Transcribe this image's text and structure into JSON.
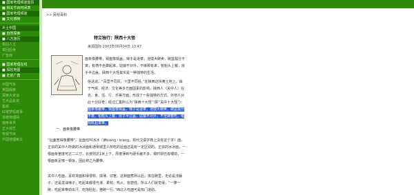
{
  "sidebar": {
    "items": [
      {
        "label": "■ 国家地理频道首页"
      },
      {
        "label": "■ 相关节目时间表"
      },
      {
        "label": "■ 国家地理频道"
      },
      {
        "label": "■ 文化博物"
      },
      {
        "label": "乡土中国"
      },
      {
        "label": "■ 自然探索"
      },
      {
        "label": "■ 八方游历"
      },
      {
        "label": "章回人文"
      },
      {
        "label": "章回后世"
      },
      {
        "label": "广告商"
      },
      {
        "label": "■ 国家地理在线"
      },
      {
        "label": "■ 探险地图"
      },
      {
        "label": "■ 史前广角"
      },
      {
        "label": "中国气象"
      },
      {
        "label": "英国探索"
      },
      {
        "label": "探索大家谈"
      },
      {
        "label": "艺术品投资"
      },
      {
        "label": "集邮"
      },
      {
        "label": "红楼梦短故事"
      },
      {
        "label": "求修地理网"
      },
      {
        "label": "咖啡世界"
      },
      {
        "label": "正大综艺"
      },
      {
        "label": "电视节目"
      },
      {
        "label": "中国地理索文"
      }
    ]
  },
  "breadcrumb": ">> 民俗百科",
  "article": {
    "title": "特立独行：陕西十大怪",
    "meta": "来源国际  2003年06月04日 13:47",
    "p1": "面条像腰带，锅盔像锅盖，辣子是道菜，泡馍大碗卖，碗盆瓢分不离，有椅不坐蹲起来，姑娘不对外，不嫁那有来，帕帕头上戴，房子半边盖。陕西十大怪其实是一种独特的生活。",
    "p2_before": "俗话说，“百里不同风，十里不同俗。”在陕西这块黄土地上，由于气候、经济、文化等多方面因素的影响，陕西人（关中人）在衣、食、住、行、乐等方面，形成了一些独特的方式。外地人对此十分好奇，经过汇集所以为“陕西十大怪”（即“关中十大怪”）：",
    "p2_highlight": "面条像腰带，锅盔像锅盖，辣子是道菜，泡馍大碗卖，碗盆瓢分不离，帕帕头上戴，房子半边盖，姑娘不对外，不坐蹲着吃，唱戏吼起来等。",
    "sec1": "一、面条像腰带",
    "p3": "“扯面宽得像腰带”。扯面也叫冰冰（读biang・biang，现代汉语字典上没有这个字）面，正宗的关中人所做的冰冰面和通常城里人所吃的扯面还是有一定区别的。正宗的冰冰面，一根面条宽度可达二三寸，长度则达1米上下，厚度薄到与硬币差不多，嚼时却仍有嚼劲，一根面条足够一顿饭，因此称之为腰带。",
    "p4": "关中人吃面，喜欢将面和得很软、揉薄、切宽。这种面煮熟以后，拣在碗里，无论是浇臊子，还是泼油辣子，吃起来都很光滑、柔软、热火、有筋性。所以人们就觉得，“一捧一碗，吃起来带劲出汗。吃饱肚肚，抱碗一行。”西北人吃面可是有门道的。"
  }
}
